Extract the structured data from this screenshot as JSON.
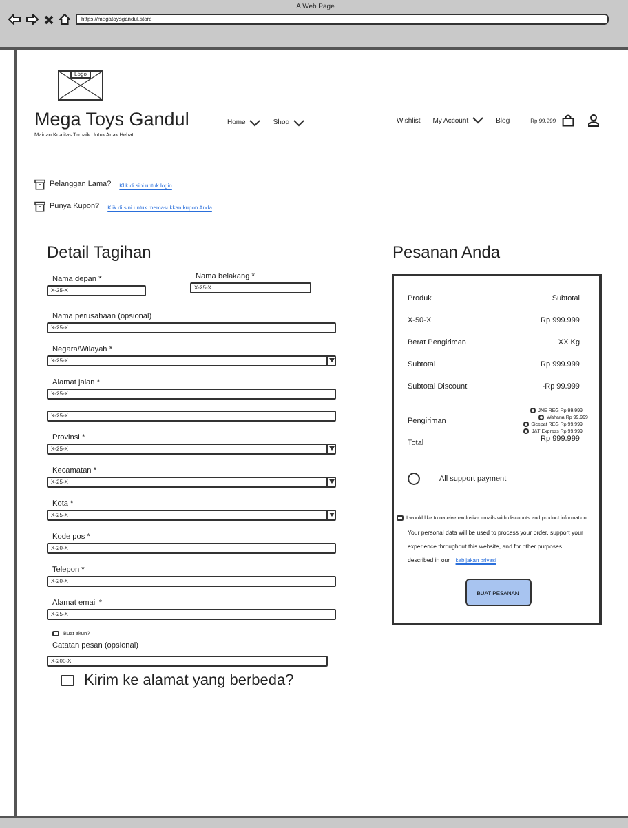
{
  "browser": {
    "title": "A Web Page",
    "url": "https://megatoysgandul.store"
  },
  "header": {
    "logo": "Logo",
    "brand": "Mega Toys Gandul",
    "tagline": "Mainan Kualitas Terbaik Untuk Anak Hebat",
    "nav_left": [
      {
        "label": "Home",
        "dropdown": true
      },
      {
        "label": "Shop",
        "dropdown": true
      }
    ],
    "nav_right": [
      {
        "label": "Wishlist",
        "dropdown": false
      },
      {
        "label": "My Account",
        "dropdown": true
      },
      {
        "label": "Blog",
        "dropdown": false
      }
    ],
    "cart_total": "Rp 99.999"
  },
  "notices": [
    {
      "text": "Pelanggan Lama?",
      "link": "Klik di sini untuk login"
    },
    {
      "text": "Punya Kupon?",
      "link": "Klik di sini untuk memasukkan kupon Anda"
    }
  ],
  "billing": {
    "title": "Detail Tagihan",
    "name_fields": [
      {
        "label": "Nama depan *",
        "value": "X-25-X"
      },
      {
        "label": "Nama belakang *",
        "value": "X-25-X"
      }
    ],
    "fields": [
      {
        "kind": "text",
        "label": "Nama perusahaan (opsional)",
        "value": "X-25-X"
      },
      {
        "kind": "select",
        "label": "Negara/Wilayah *",
        "value": "X-25-X"
      },
      {
        "kind": "text",
        "label": "Alamat jalan *",
        "value": "X-25-X"
      },
      {
        "kind": "text",
        "value": "X-25-X"
      },
      {
        "kind": "select",
        "label": "Provinsi *",
        "value": "X-25-X"
      },
      {
        "kind": "select",
        "label": "Kecamatan *",
        "value": "X-25-X"
      },
      {
        "kind": "select",
        "label": "Kota *",
        "value": "X-25-X"
      },
      {
        "kind": "text",
        "label": "Kode pos *",
        "value": "X-20-X"
      },
      {
        "kind": "text",
        "label": "Telepon *",
        "value": "X-20-X"
      },
      {
        "kind": "text",
        "label": "Alamat email *",
        "value": "X-25-X"
      }
    ],
    "create_account": {
      "label": "Buat akun?",
      "checked": false
    },
    "notes": {
      "label": "Catatan pesan (opsional)",
      "value": "X-200-X"
    },
    "ship_different": {
      "label": "Kirim ke alamat yang berbeda?",
      "checked": false
    }
  },
  "order": {
    "title": "Pesanan Anda",
    "columns": [
      "Produk",
      "Subtotal"
    ],
    "rows": [
      [
        "X-50-X",
        "Rp 999.999"
      ],
      [
        "Berat Pengiriman",
        "XX Kg"
      ],
      [
        "Subtotal",
        "Rp 999.999"
      ],
      [
        "Subtotal Discount",
        "-Rp 99.999"
      ]
    ],
    "shipping_label": "Pengiriman",
    "shipping_options": [
      {
        "label": "JNE REG Rp 99.999",
        "selected": false
      },
      {
        "label": "Wahana Rp 99.999",
        "selected": false
      },
      {
        "label": "Sicepat REG Rp 99.999",
        "selected": false
      },
      {
        "label": "J&T Express Rp 99.999",
        "selected": false
      }
    ],
    "total_label": "Total",
    "total": "Rp 999.999",
    "payment": {
      "label": "All support payment",
      "selected": false
    },
    "newsletter": {
      "label": "I would like to receive exclusive emails with discounts and product information",
      "checked": false
    },
    "privacy_text": "Your personal data will be used to process your order, support your experience throughout this website, and for other purposes described in our",
    "privacy_link": "kebijakan privasi",
    "button": "BUAT PESANAN"
  }
}
